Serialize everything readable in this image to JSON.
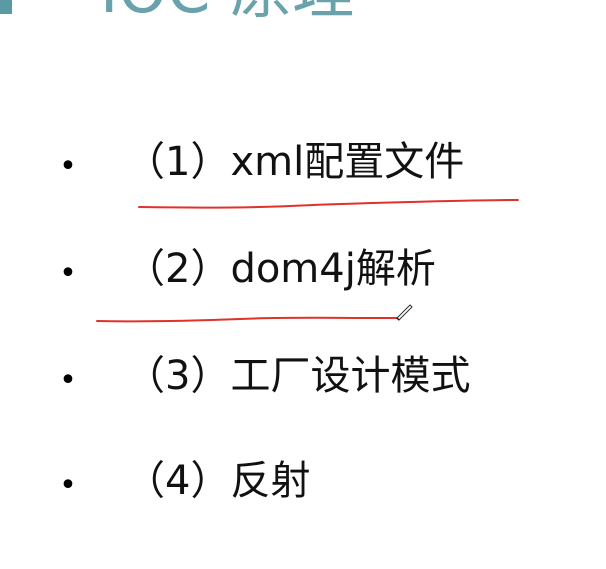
{
  "slide": {
    "title": "IOC 原理",
    "items": [
      {
        "bullet": "•",
        "text": "（1）xml配置文件"
      },
      {
        "bullet": "•",
        "text": "（2）dom4j解析"
      },
      {
        "bullet": "•",
        "text": "（3）工厂设计模式"
      },
      {
        "bullet": "•",
        "text": "（4）反射"
      }
    ]
  },
  "colors": {
    "title": "#6aa2ab",
    "accent": "#5a9aa3",
    "text": "#111111",
    "underline": "#e0322b"
  },
  "icons": {
    "cursor": "pen-cursor-icon"
  }
}
